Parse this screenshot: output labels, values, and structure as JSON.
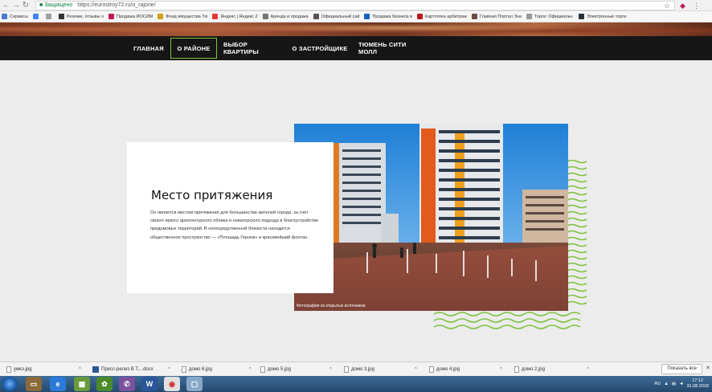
{
  "browser": {
    "back_icon": "back-arrow-icon",
    "forward_icon": "forward-arrow-icon",
    "reload_icon": "reload-icon",
    "secure_label": "Защищено",
    "url": "https://eurostroy72.ru/o_rajone/"
  },
  "bookmarks": [
    {
      "label": "Сервисы",
      "color": "#4a7bd0"
    },
    {
      "label": "",
      "color": "#4285f4"
    },
    {
      "label": "",
      "color": "#a0a0a0"
    },
    {
      "label": "Резюме, отзывы о",
      "color": "#333333"
    },
    {
      "label": "Продажа ИОСИМ",
      "color": "#c2185b"
    },
    {
      "label": "Фонд имущества Тю",
      "color": "#d4a017"
    },
    {
      "label": "Яндекс | Яндекс 2",
      "color": "#e53935"
    },
    {
      "label": "Аренда и продажа",
      "color": "#777777"
    },
    {
      "label": "Официальный сай",
      "color": "#555555"
    },
    {
      "label": "Продажа бизнеса в",
      "color": "#1565c0"
    },
    {
      "label": "Картотека арбитраж",
      "color": "#b71c1c"
    },
    {
      "label": "Главная Портал Зна",
      "color": "#6d4c41"
    },
    {
      "label": "Торги: Официальн.",
      "color": "#999999"
    },
    {
      "label": "Электронные торги",
      "color": "#263238"
    }
  ],
  "nav": {
    "items": [
      {
        "label": "ГЛАВНАЯ"
      },
      {
        "label": "О РАЙОНЕ"
      },
      {
        "label": "ВЫБОР КВАРТИРЫ"
      },
      {
        "label": "О ЗАСТРОЙЩИКЕ"
      },
      {
        "label": "ТЮМЕНЬ СИТИ МОЛЛ"
      }
    ]
  },
  "content": {
    "title": "Место притяжения",
    "text": "Он является местом притяжения для большинства жителей города, за счет своего яркого архитектурного облика и новаторского подхода в благоустройстве придомовых территорий. В непосредственной близости находится общественное пространство — «Площадь Героев» и красивейший фонтан.",
    "photo_caption": "Фотография из открытых источников"
  },
  "downloads": {
    "items": [
      {
        "label": "умкэ.jpg",
        "icon": "file-icon"
      },
      {
        "label": "Пресс-релиз В Т....docx",
        "icon": "word-icon"
      },
      {
        "label": "домо 6.jpg",
        "icon": "file-icon"
      },
      {
        "label": "домо 5.jpg",
        "icon": "file-icon"
      },
      {
        "label": "домо 3.jpg",
        "icon": "file-icon"
      },
      {
        "label": "домо 4.jpg",
        "icon": "file-icon"
      },
      {
        "label": "домо 2.jpg",
        "icon": "file-icon"
      }
    ],
    "show_all": "Показать все"
  },
  "taskbar": {
    "lang": "RU",
    "time": "17:12",
    "date": "31.08.2018"
  },
  "colors": {
    "accent_green": "#7fc242",
    "nav_bg": "#161616"
  }
}
